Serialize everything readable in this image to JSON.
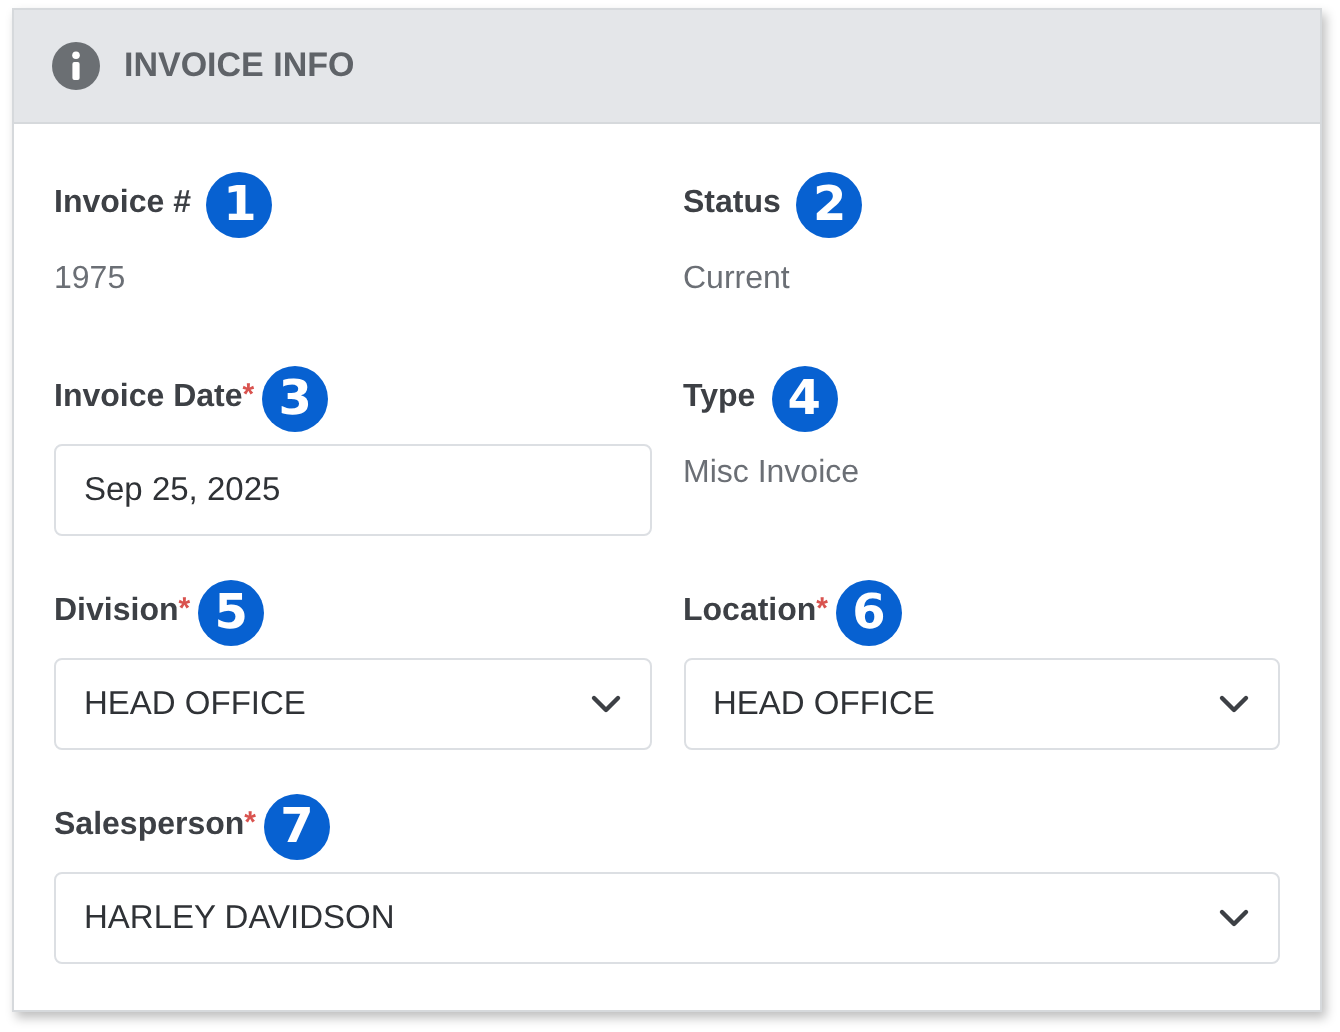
{
  "panel": {
    "title": "INVOICE INFO"
  },
  "fields": [
    {
      "kind": "text",
      "label": "Invoice #",
      "badge": "1",
      "value": "1975",
      "wide": false
    },
    {
      "kind": "text",
      "label": "Status",
      "badge": "2",
      "value": "Current",
      "wide": false
    },
    {
      "kind": "input",
      "label": "Invoice Date",
      "required_mark": "*",
      "badge": "3",
      "value": "Sep 25, 2025",
      "wide": false
    },
    {
      "kind": "text",
      "label": "Type",
      "badge": "4",
      "value": "Misc Invoice",
      "wide": false
    },
    {
      "kind": "select",
      "label": "Division",
      "required_mark": "*",
      "badge": "5",
      "value": "HEAD OFFICE",
      "wide": false
    },
    {
      "kind": "select",
      "label": "Location",
      "required_mark": "*",
      "badge": "6",
      "value": "HEAD OFFICE",
      "wide": false
    },
    {
      "kind": "select",
      "label": "Salesperson",
      "required_mark": "*",
      "badge": "7",
      "value": "HARLEY DAVIDSON",
      "wide": true
    }
  ]
}
